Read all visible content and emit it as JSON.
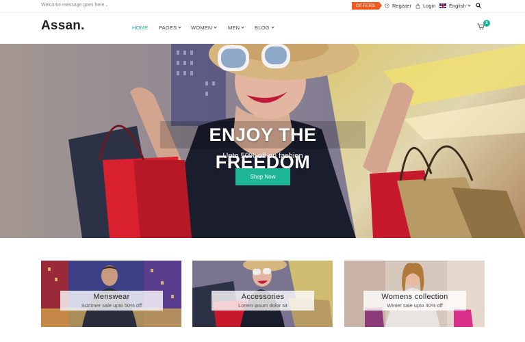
{
  "topbar": {
    "welcome": "Welcome message goes here...",
    "offers": "OFFERS",
    "register": "Register",
    "login": "Login",
    "language": "English"
  },
  "header": {
    "logo": "Assan.",
    "nav": [
      {
        "label": "HOME",
        "active": true
      },
      {
        "label": "PAGES"
      },
      {
        "label": "WOMEN"
      },
      {
        "label": "MEN"
      },
      {
        "label": "BLOG"
      }
    ],
    "cart_count": "5"
  },
  "hero": {
    "title": "ENJOY THE FREEDOM",
    "subtitle": "Upto 50% off on fashion",
    "button": "Shop Now"
  },
  "categories": [
    {
      "title": "Menswear",
      "subtitle": "Summer sale upto 50% off"
    },
    {
      "title": "Accessories",
      "subtitle": "Lorem ipsum dolor sit"
    },
    {
      "title": "Womens collection",
      "subtitle": "Winter sale upto 40% off"
    }
  ],
  "colors": {
    "accent": "#1fb597",
    "offers": "#f45a1e"
  },
  "icons": [
    "clock-icon",
    "lock-icon",
    "uk-flag-icon",
    "search-icon",
    "cart-icon"
  ]
}
